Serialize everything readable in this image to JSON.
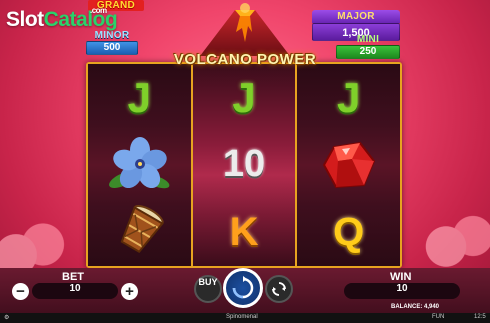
{
  "watermark": {
    "part1": "Slot",
    "part2": "Catalog",
    "part3": ".com"
  },
  "game": {
    "title": "VOLCANO POWER"
  },
  "jackpots": {
    "grand": {
      "label": "GRAND",
      "value": ""
    },
    "minor": {
      "label": "MINOR",
      "value": "500"
    },
    "major": {
      "label": "MAJOR",
      "value": "1,500"
    },
    "mini": {
      "label": "MINI",
      "value": "250"
    }
  },
  "reels": [
    [
      "J",
      "hibiscus-flower",
      "drum"
    ],
    [
      "J",
      "10",
      "K"
    ],
    [
      "J",
      "ruby-gem",
      "Q"
    ]
  ],
  "controls": {
    "bet_label": "BET",
    "bet_value": "10",
    "minus": "−",
    "plus": "+",
    "buy_label": "BUY",
    "win_label": "WIN",
    "win_value": "10",
    "balance_label": "BALANCE:",
    "balance_value": "4,940"
  },
  "statusbar": {
    "provider": "Spinomenal",
    "mode": "FUN",
    "time": "12:5"
  },
  "colors": {
    "reel_border": "#e7a320",
    "bg_pink": "#f0456b",
    "spin_blue": "#1c4fa0"
  }
}
